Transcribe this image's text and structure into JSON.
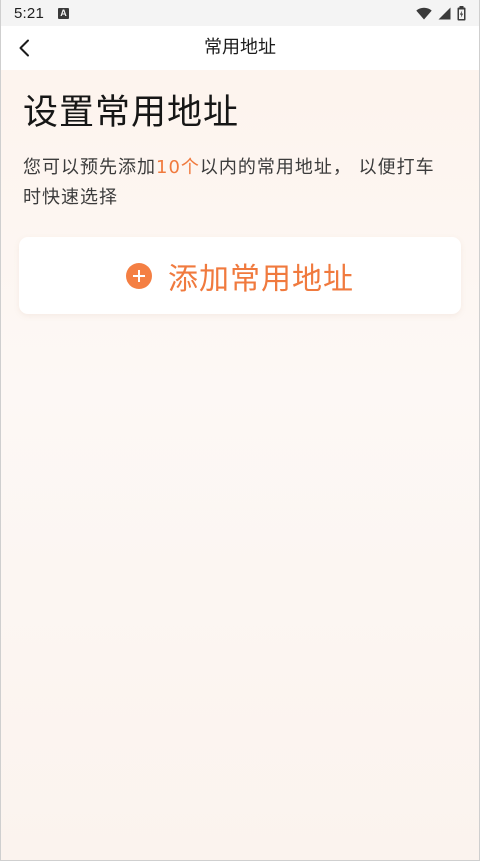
{
  "status_bar": {
    "time": "5:21",
    "notification_icon_letter": "A",
    "icons": [
      "wifi-icon",
      "cellular-signal-icon",
      "battery-icon"
    ]
  },
  "nav": {
    "back_icon": "chevron-left-icon",
    "title": "常用地址"
  },
  "main": {
    "heading": "设置常用地址",
    "description_prefix": "您可以预先添加",
    "description_highlight": "10个",
    "description_suffix": "以内的常用地址， 以便打车时快速选择",
    "add_button_label": "添加常用地址",
    "add_icon": "plus-circle-icon"
  },
  "colors": {
    "accent": "#f07a3e",
    "accent_icon": "#f47f43",
    "text_primary": "#161616",
    "text_secondary": "#3c3c3c",
    "card_background": "#ffffff",
    "page_background": "#fdf6f1"
  }
}
